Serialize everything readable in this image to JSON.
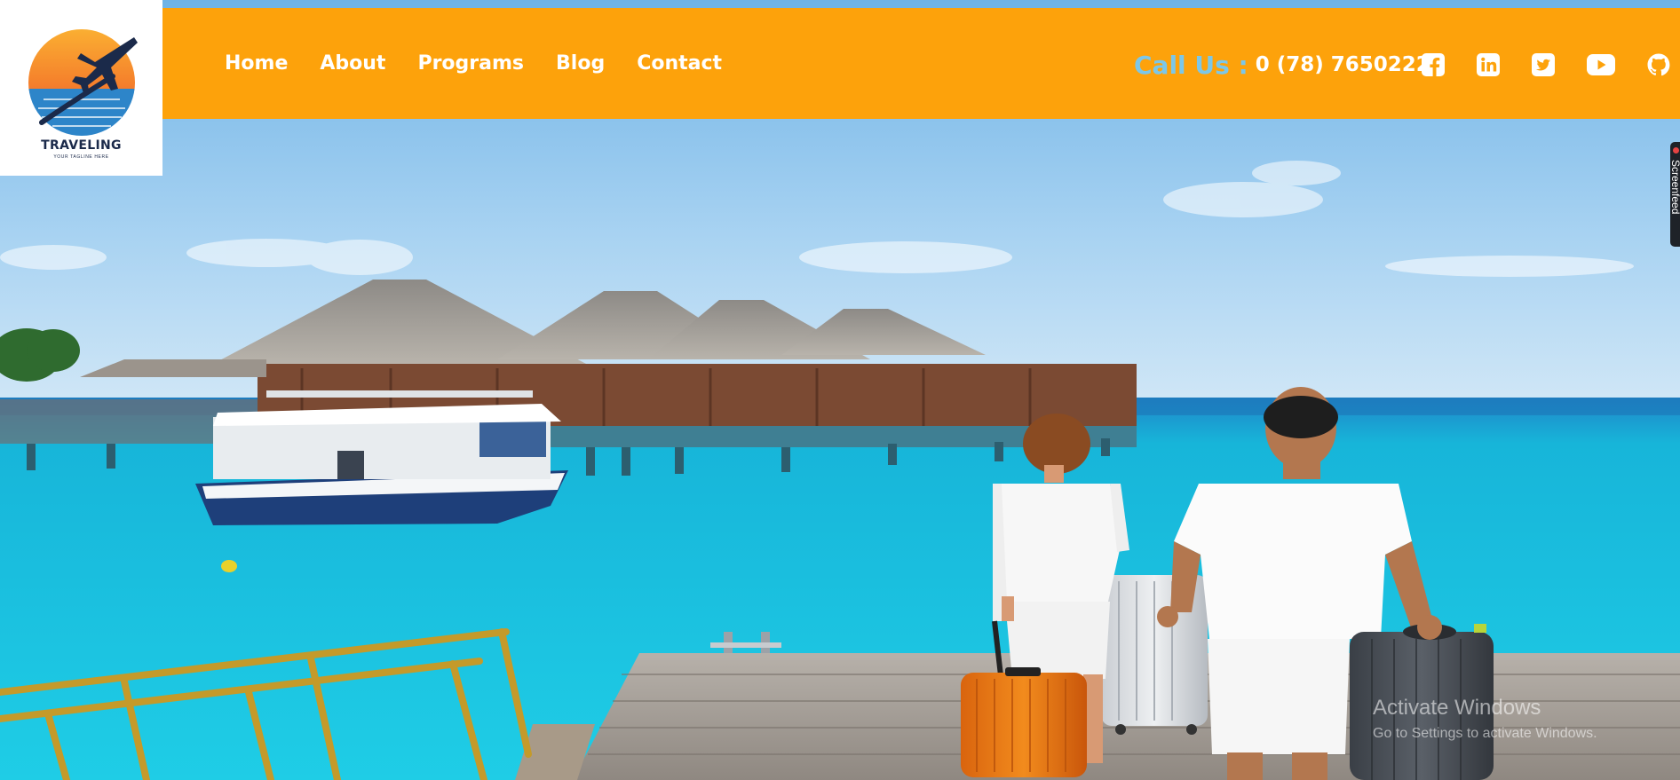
{
  "brand": {
    "name": "TRAVELING",
    "tagline": "YOUR TAGLINE HERE"
  },
  "nav": {
    "items": [
      {
        "label": "Home"
      },
      {
        "label": "About"
      },
      {
        "label": "Programs"
      },
      {
        "label": "Blog"
      },
      {
        "label": "Contact"
      }
    ]
  },
  "contact": {
    "label": "Call Us :",
    "phone": "0 (78) 7650222"
  },
  "socials": [
    "facebook-icon",
    "linkedin-icon",
    "twitter-icon",
    "youtube-icon",
    "github-icon"
  ],
  "side_tab": {
    "label": "Screenfeed"
  },
  "watermark": {
    "title": "Activate Windows",
    "subtitle": "Go to Settings to activate Windows."
  },
  "colors": {
    "nav_bg": "#fda20b",
    "call_label": "#7cc7e8",
    "nav_text": "#ffffff"
  }
}
